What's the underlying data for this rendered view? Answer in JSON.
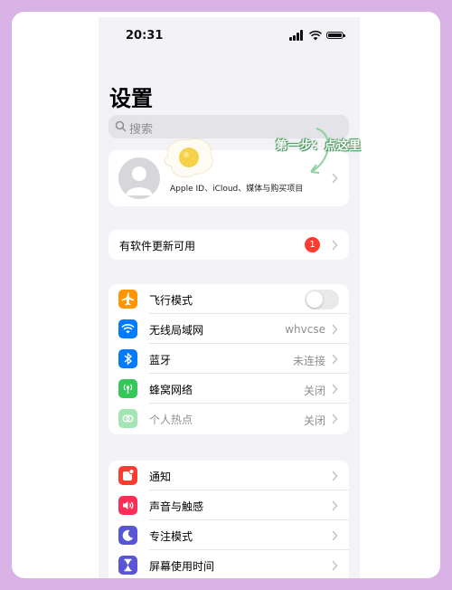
{
  "status_bar": {
    "time": "20:31"
  },
  "page_title": "设置",
  "search": {
    "placeholder": "搜索"
  },
  "profile": {
    "subtitle": "Apple ID、iCloud、媒体与购买项目"
  },
  "update": {
    "label": "有软件更新可用",
    "badge": "1"
  },
  "connectivity": [
    {
      "label": "飞行模式",
      "icon": "airplane-icon",
      "color": "#ff9500",
      "toggle": false
    },
    {
      "label": "无线局域网",
      "icon": "wifi-icon",
      "color": "#007aff",
      "value": "whvcse"
    },
    {
      "label": "蓝牙",
      "icon": "bluetooth-icon",
      "color": "#007aff",
      "value": "未连接"
    },
    {
      "label": "蜂窝网络",
      "icon": "cellular-icon",
      "color": "#34c759",
      "value": "关闭"
    },
    {
      "label": "个人热点",
      "icon": "hotspot-icon",
      "color": "#34c759",
      "value": "关闭",
      "disabled": true
    }
  ],
  "notifications_group": [
    {
      "label": "通知",
      "icon": "notification-icon",
      "color": "#ff3b30"
    },
    {
      "label": "声音与触感",
      "icon": "sound-icon",
      "color": "#ff2d55"
    },
    {
      "label": "专注模式",
      "icon": "moon-icon",
      "color": "#5856d6"
    },
    {
      "label": "屏幕使用时间",
      "icon": "hourglass-icon",
      "color": "#5856d6"
    }
  ],
  "annotation": {
    "text": "第一步：点这里"
  }
}
